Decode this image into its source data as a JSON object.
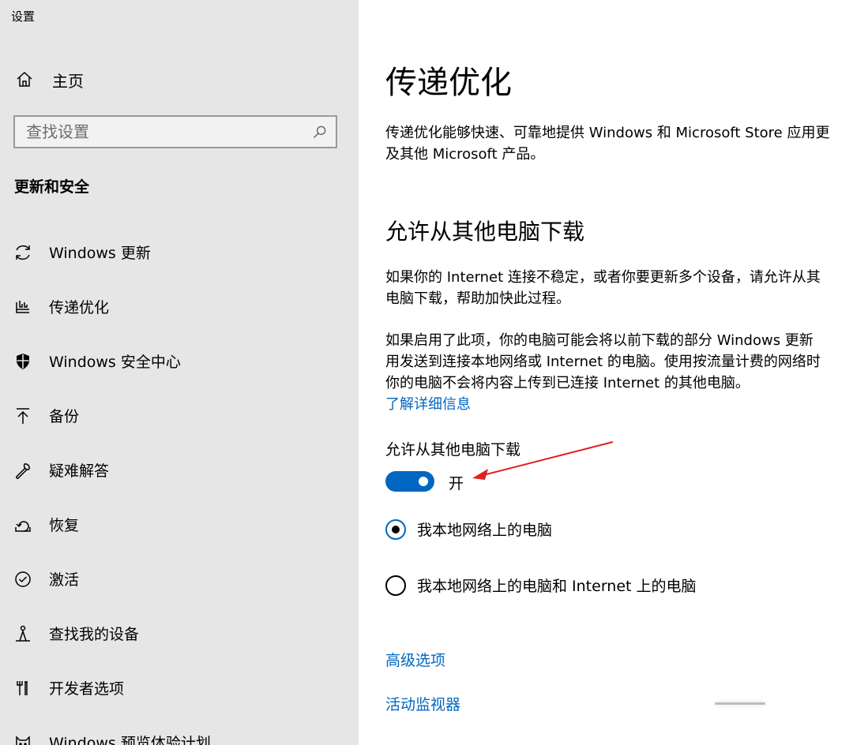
{
  "app": {
    "title": "设置"
  },
  "sidebar": {
    "home_label": "主页",
    "search_placeholder": "查找设置",
    "section_title": "更新和安全",
    "items": [
      {
        "label": "Windows 更新",
        "icon": "sync-icon"
      },
      {
        "label": "传递优化",
        "icon": "delivery-optimization-icon"
      },
      {
        "label": "Windows 安全中心",
        "icon": "shield-icon"
      },
      {
        "label": "备份",
        "icon": "backup-arrow-icon"
      },
      {
        "label": "疑难解答",
        "icon": "wrench-icon"
      },
      {
        "label": "恢复",
        "icon": "recovery-icon"
      },
      {
        "label": "激活",
        "icon": "check-circle-icon"
      },
      {
        "label": "查找我的设备",
        "icon": "person-location-icon"
      },
      {
        "label": "开发者选项",
        "icon": "developer-tools-icon"
      },
      {
        "label": "Windows 预览体验计划",
        "icon": "insider-cat-icon"
      }
    ]
  },
  "main": {
    "title": "传递优化",
    "intro_line1": "传递优化能够快速、可靠地提供 Windows 和 Microsoft Store 应用更",
    "intro_line2": "及其他 Microsoft 产品。",
    "section_heading": "允许从其他电脑下载",
    "para1_line1": "如果你的 Internet 连接不稳定，或者你要更新多个设备，请允许从其",
    "para1_line2": "电脑下载，帮助加快此过程。",
    "para2_line1": "如果启用了此项，你的电脑可能会将以前下载的部分 Windows 更新",
    "para2_line2": "用发送到连接本地网络或 Internet 的电脑。使用按流量计费的网络时",
    "para2_line3": "你的电脑不会将内容上传到已连接 Internet 的其他电脑。",
    "learn_more": "了解详细信息",
    "toggle_label": "允许从其他电脑下载",
    "toggle_state": "开",
    "toggle_on": true,
    "radio_local": "我本地网络上的电脑",
    "radio_internet": "我本地网络上的电脑和 Internet 上的电脑",
    "selected_radio": "local",
    "advanced_link": "高级选项",
    "activity_link": "活动监视器"
  },
  "colors": {
    "accent": "#0067c0",
    "sidebar_bg": "#e6e6e6",
    "annotation_arrow": "#e02020"
  }
}
